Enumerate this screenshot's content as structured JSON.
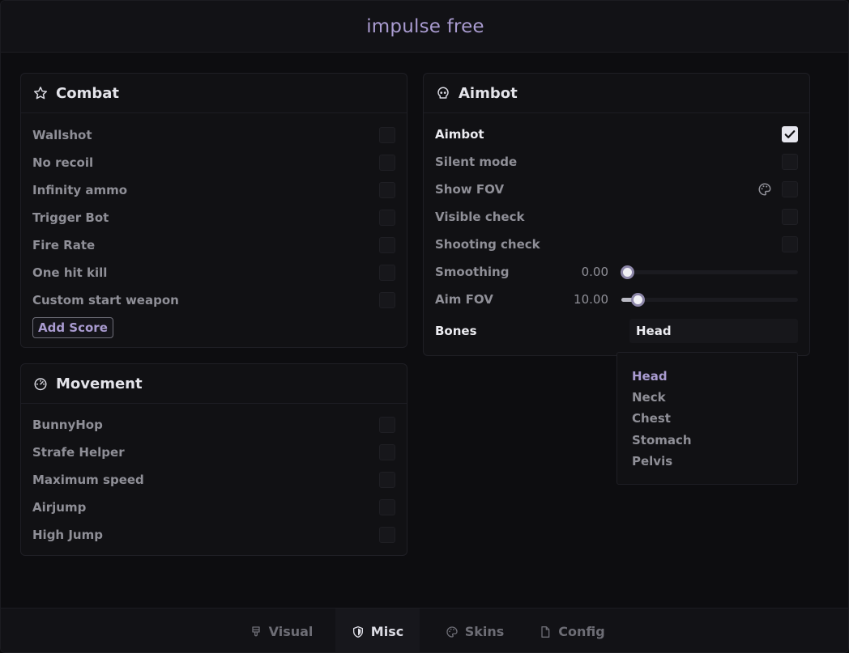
{
  "app": {
    "title": "impulse free"
  },
  "combat": {
    "title": "Combat",
    "icon": "star-icon",
    "items": [
      {
        "label": "Wallshot",
        "checked": false
      },
      {
        "label": "No recoil",
        "checked": false
      },
      {
        "label": "Infinity ammo",
        "checked": false
      },
      {
        "label": "Trigger Bot",
        "checked": false
      },
      {
        "label": "Fire Rate",
        "checked": false
      },
      {
        "label": "One hit kill",
        "checked": false
      },
      {
        "label": "Custom start weapon",
        "checked": false
      }
    ],
    "add_score_label": "Add Score"
  },
  "movement": {
    "title": "Movement",
    "icon": "speedometer-icon",
    "items": [
      {
        "label": "BunnyHop",
        "checked": false
      },
      {
        "label": "Strafe Helper",
        "checked": false
      },
      {
        "label": "Maximum speed",
        "checked": false
      },
      {
        "label": "Airjump",
        "checked": false
      },
      {
        "label": "High Jump",
        "checked": false
      }
    ]
  },
  "aimbot": {
    "title": "Aimbot",
    "icon": "skull-icon",
    "items": [
      {
        "label": "Aimbot",
        "checked": true
      },
      {
        "label": "Silent mode",
        "checked": false
      },
      {
        "label": "Show FOV",
        "checked": false,
        "has_color_picker": true
      },
      {
        "label": "Visible check",
        "checked": false
      },
      {
        "label": "Shooting check",
        "checked": false
      }
    ],
    "sliders": [
      {
        "label": "Smoothing",
        "value": "0.00",
        "fraction": 0.0
      },
      {
        "label": "Aim FOV",
        "value": "10.00",
        "fraction": 0.06
      }
    ],
    "bones": {
      "label": "Bones",
      "selected": "Head",
      "options": [
        "Head",
        "Neck",
        "Chest",
        "Stomach",
        "Pelvis"
      ]
    }
  },
  "tabs": [
    {
      "label": "Visual",
      "icon": "brush-icon",
      "active": false
    },
    {
      "label": "Misc",
      "icon": "shield-icon",
      "active": true
    },
    {
      "label": "Skins",
      "icon": "palette-icon",
      "active": false
    },
    {
      "label": "Config",
      "icon": "file-icon",
      "active": false
    }
  ],
  "colors": {
    "accent": "#a99bd0",
    "background": "#0d0d10",
    "panel": "#111114"
  }
}
